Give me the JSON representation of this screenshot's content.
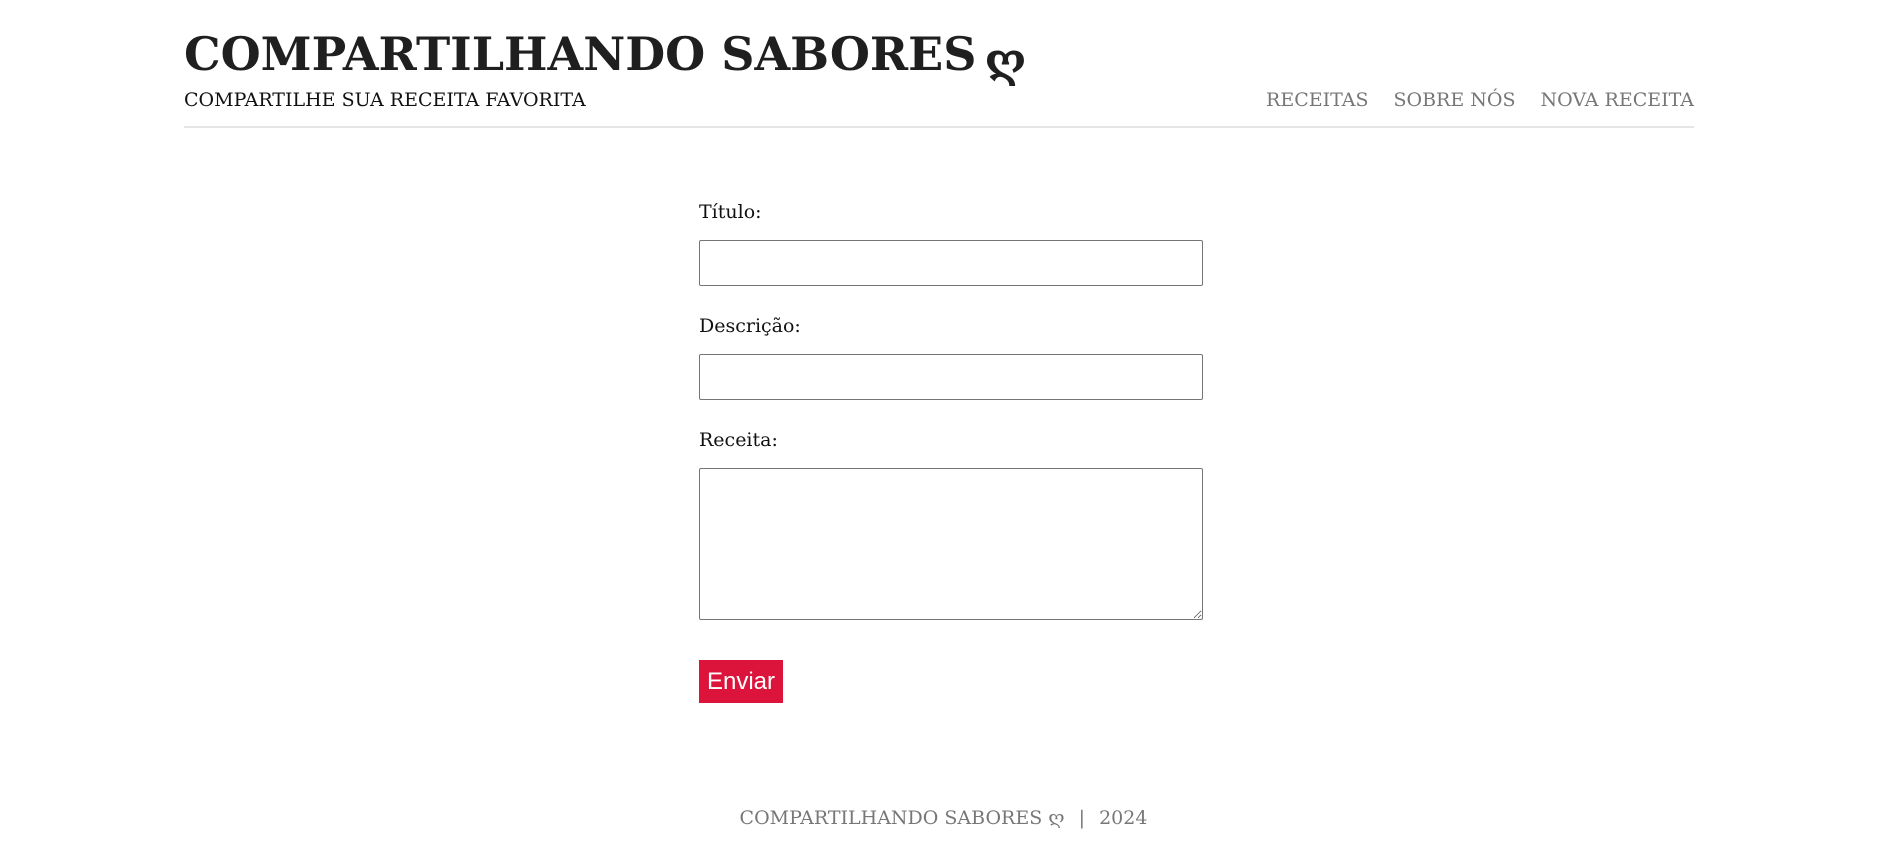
{
  "header": {
    "title": "COMPARTILHANDO SABORES",
    "title_glyph": "ღ",
    "tagline": "COMPARTILHE SUA RECEITA FAVORITA",
    "nav": [
      {
        "label": "RECEITAS"
      },
      {
        "label": "SOBRE NÓS"
      },
      {
        "label": "NOVA RECEITA"
      }
    ]
  },
  "form": {
    "titulo_label": "Título:",
    "titulo_value": "",
    "descricao_label": "Descrição:",
    "descricao_value": "",
    "receita_label": "Receita:",
    "receita_value": "",
    "submit_label": "Enviar"
  },
  "footer": {
    "site_name": "COMPARTILHANDO SABORES",
    "glyph": "ღ",
    "separator": "|",
    "year": "2024"
  },
  "colors": {
    "accent": "#dc143c",
    "nav_text": "#777777",
    "title_text": "#1f1f1f",
    "header_border": "#e6e6e6"
  }
}
